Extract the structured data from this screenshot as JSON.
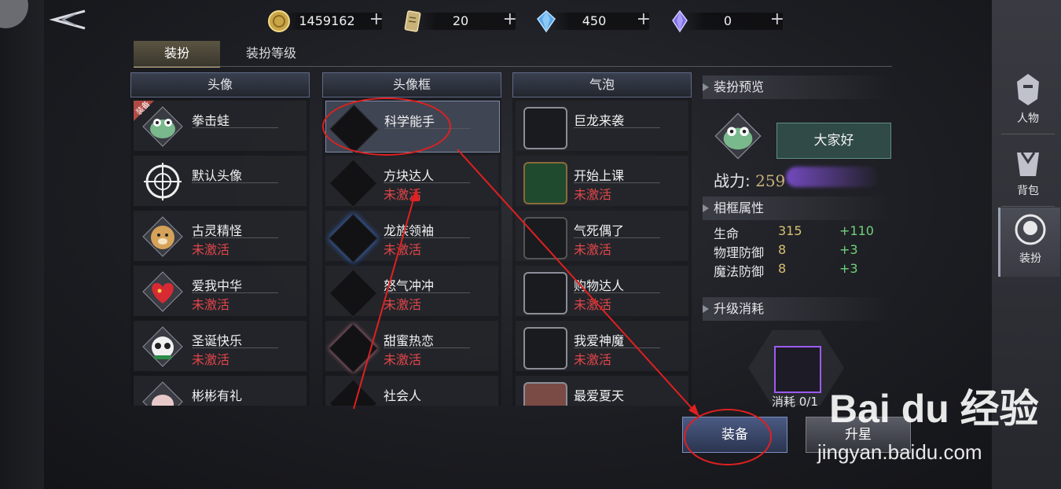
{
  "currencies": [
    {
      "icon": "gold-coin-icon",
      "value": "1459162",
      "plus": "+"
    },
    {
      "icon": "ticket-icon",
      "value": "20",
      "plus": "+"
    },
    {
      "icon": "blue-crystal-icon",
      "value": "450",
      "plus": "+"
    },
    {
      "icon": "purple-crystal-icon",
      "value": "0",
      "plus": "+"
    }
  ],
  "tabs": [
    {
      "label": "装扮",
      "active": true
    },
    {
      "label": "装扮等级",
      "active": false
    }
  ],
  "columns": {
    "avatar": {
      "title": "头像",
      "items": [
        {
          "name": "拳击蛙",
          "status": "",
          "badge": "装备"
        },
        {
          "name": "默认头像",
          "status": ""
        },
        {
          "name": "古灵精怪",
          "status": "未激活"
        },
        {
          "name": "爱我中华",
          "status": "未激活"
        },
        {
          "name": "圣诞快乐",
          "status": "未激活"
        },
        {
          "name": "彬彬有礼",
          "status": ""
        }
      ]
    },
    "frame": {
      "title": "头像框",
      "items": [
        {
          "name": "科学能手",
          "status": "",
          "selected": true
        },
        {
          "name": "方块达人",
          "status": "未激活"
        },
        {
          "name": "龙族领袖",
          "status": "未激活"
        },
        {
          "name": "怒气冲冲",
          "status": "未激活"
        },
        {
          "name": "甜蜜热恋",
          "status": "未激活"
        },
        {
          "name": "社会人",
          "status": ""
        }
      ]
    },
    "bubble": {
      "title": "气泡",
      "items": [
        {
          "name": "巨龙来袭",
          "status": ""
        },
        {
          "name": "开始上课",
          "status": "未激活"
        },
        {
          "name": "气死偶了",
          "status": "未激活"
        },
        {
          "name": "购物达人",
          "status": "未激活"
        },
        {
          "name": "我爱神魔",
          "status": "未激活"
        },
        {
          "name": "最爱夏天",
          "status": ""
        }
      ]
    }
  },
  "preview": {
    "title": "装扮预览",
    "speech": "大家好",
    "power_label": "战力:",
    "power_value": "259"
  },
  "attributes": {
    "title": "相框属性",
    "rows": [
      {
        "name": "生命",
        "value": "315",
        "add": "+110"
      },
      {
        "name": "物理防御",
        "value": "8",
        "add": "+3"
      },
      {
        "name": "魔法防御",
        "value": "8",
        "add": "+3"
      }
    ]
  },
  "upgrade_cost": {
    "title": "升级消耗",
    "text": "消耗 0/1"
  },
  "buttons": {
    "equip": "装备",
    "upgrade": "升星"
  },
  "right_nav": [
    {
      "label": "人物",
      "icon": "helmet-icon",
      "active": false
    },
    {
      "label": "背包",
      "icon": "bag-icon",
      "active": false
    },
    {
      "label": "装扮",
      "icon": "dressup-icon",
      "active": true
    }
  ],
  "watermark": {
    "main": "Bai du 经验",
    "sub": "jingyan.baidu.com"
  },
  "colors": {
    "inactive": "#e0464a",
    "annotation": "#e02020",
    "attr_value": "#d7c06f",
    "attr_add": "#6fd27a"
  }
}
